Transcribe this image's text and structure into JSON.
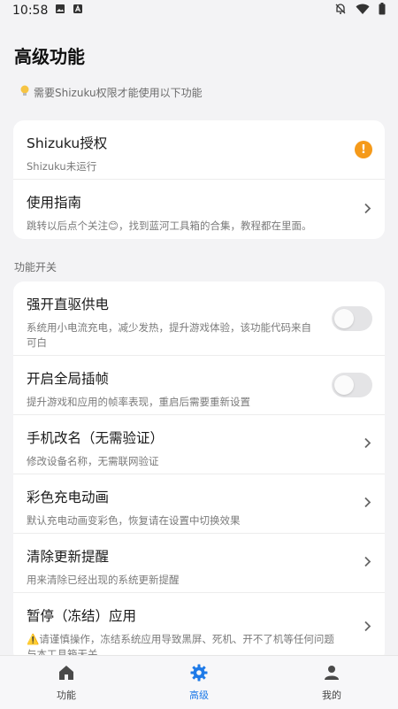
{
  "status_bar": {
    "time": "10:58"
  },
  "header": {
    "title": "高级功能"
  },
  "notice": {
    "icon": "lightbulb-icon",
    "text": "需要Shizuku权限才能使用以下功能"
  },
  "top_card": {
    "items": [
      {
        "title": "Shizuku授权",
        "subtitle": "Shizuku未运行",
        "right": "warning"
      },
      {
        "title": "使用指南",
        "subtitle": "跳转以后点个关注😊，找到蓝河工具箱的合集，教程都在里面。",
        "right": "chevron"
      }
    ]
  },
  "section": {
    "label": "功能开关"
  },
  "features": [
    {
      "title": "强开直驱供电",
      "subtitle": "系统用小电流充电，减少发热，提升游戏体验，该功能代码来自可白",
      "toggle": false
    },
    {
      "title": "开启全局插帧",
      "subtitle": "提升游戏和应用的帧率表现，重启后需要重新设置",
      "toggle": false
    },
    {
      "title": "手机改名（无需验证）",
      "subtitle": "修改设备名称，无需联网验证"
    },
    {
      "title": "彩色充电动画",
      "subtitle": "默认充电动画变彩色，恢复请在设置中切换效果"
    },
    {
      "title": "清除更新提醒",
      "subtitle": "用来清除已经出现的系统更新提醒"
    },
    {
      "title": "暂停（冻结）应用",
      "subtitle": "⚠️请谨慎操作，冻结系统应用导致黑屏、死机、开不了机等任何问题与本工具箱无关"
    }
  ],
  "bottom_nav": [
    {
      "label": "功能",
      "icon": "home-icon",
      "active": false
    },
    {
      "label": "高级",
      "icon": "gear-icon",
      "active": true
    },
    {
      "label": "我的",
      "icon": "person-icon",
      "active": false
    }
  ],
  "colors": {
    "accent": "#1e7ae8",
    "warning": "#f59a1a",
    "background": "#f3f3f5"
  }
}
